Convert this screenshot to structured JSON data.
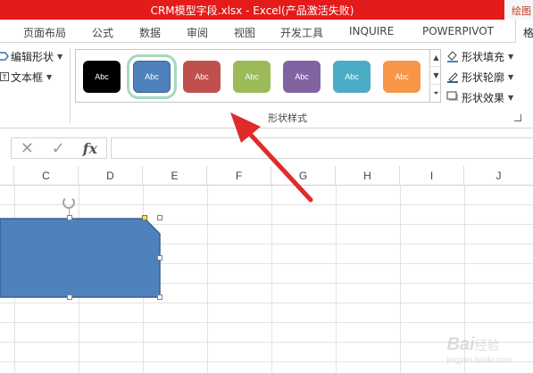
{
  "window": {
    "title": "CRM模型字段.xlsx -   Excel(产品激活失败)",
    "context_tab": "绘图"
  },
  "tabs": [
    {
      "label": "页面布局"
    },
    {
      "label": "公式"
    },
    {
      "label": "数据"
    },
    {
      "label": "审阅"
    },
    {
      "label": "视图"
    },
    {
      "label": "开发工具"
    },
    {
      "label": "INQUIRE"
    },
    {
      "label": "POWERPIVOT"
    },
    {
      "label": "格"
    }
  ],
  "insert_shapes": {
    "edit_shape": "编辑形状",
    "text_box": "文本框"
  },
  "shape_styles": {
    "group_label": "形状样式",
    "swatches": [
      {
        "label": "Abc",
        "color": "#000000"
      },
      {
        "label": "Abc",
        "color": "#4f81bd",
        "selected": true
      },
      {
        "label": "Abc",
        "color": "#c0504d"
      },
      {
        "label": "Abc",
        "color": "#9bbb59"
      },
      {
        "label": "Abc",
        "color": "#8064a2"
      },
      {
        "label": "Abc",
        "color": "#4bacc6"
      },
      {
        "label": "Abc",
        "color": "#f79646"
      }
    ],
    "commands": {
      "fill": "形状填充",
      "outline": "形状轮廓",
      "effects": "形状效果"
    }
  },
  "formula_bar": {
    "cancel": "✕",
    "enter": "✓",
    "fx": "fx",
    "value": ""
  },
  "columns": [
    "C",
    "D",
    "E",
    "F",
    "G",
    "H",
    "I",
    "J"
  ],
  "shape": {
    "fill_color": "#4f81bd",
    "outline_color": "#3a6290"
  },
  "annotation": {
    "arrow_color": "#e12a2a"
  },
  "watermark": {
    "text": "Bai",
    "suffix": "经验",
    "sub": "jingyan.baidu.com"
  }
}
